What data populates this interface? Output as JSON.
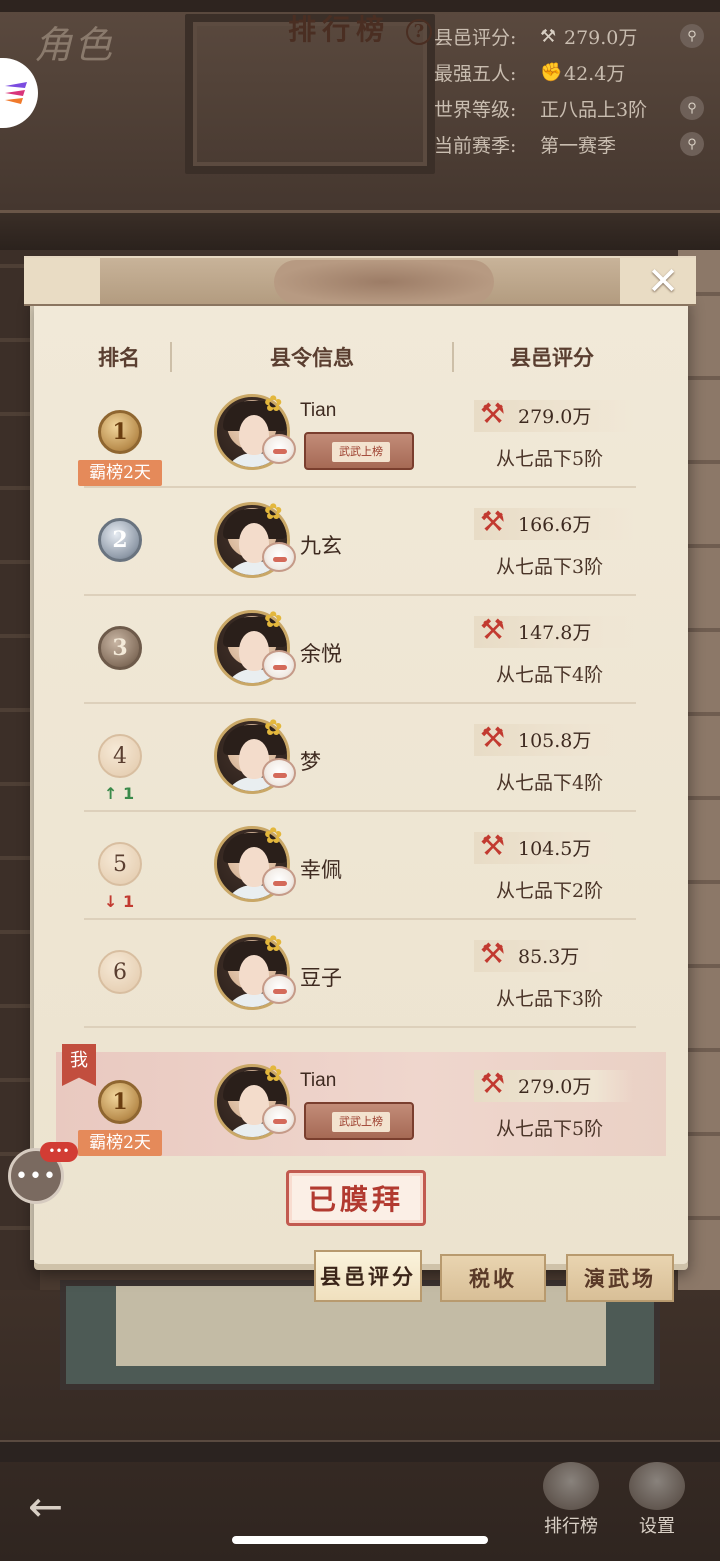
{
  "page": {
    "title": "角色"
  },
  "stats": [
    {
      "label": "县邑评分:",
      "icon": "axe-icon",
      "glyph": "⚒",
      "value": "279.0万"
    },
    {
      "label": "最强五人:",
      "icon": "fist-icon",
      "glyph": "✊",
      "value": "42.4万"
    },
    {
      "label": "世界等级:",
      "icon": "",
      "glyph": "",
      "value": "正八品上3阶"
    },
    {
      "label": "当前赛季:",
      "icon": "",
      "glyph": "",
      "value": "第一赛季"
    }
  ],
  "board": {
    "title": "排行榜",
    "help": "?",
    "close": "✕",
    "headers": {
      "rank": "排名",
      "info": "县令信息",
      "score": "县邑评分"
    },
    "rows": [
      {
        "rank": "1",
        "medal": "gold",
        "tag": "霸榜2天",
        "change": "",
        "name": "Tian",
        "badge": "武武上榜",
        "score": "279.0万",
        "grade": "从七品下5阶"
      },
      {
        "rank": "2",
        "medal": "silver",
        "tag": "",
        "change": "",
        "name": "九玄",
        "badge": "",
        "score": "166.6万",
        "grade": "从七品下3阶"
      },
      {
        "rank": "3",
        "medal": "bronze",
        "tag": "",
        "change": "",
        "name": "余悦",
        "badge": "",
        "score": "147.8万",
        "grade": "从七品下4阶"
      },
      {
        "rank": "4",
        "medal": "plain",
        "tag": "",
        "change": "↑ 1",
        "name": "梦",
        "badge": "",
        "score": "105.8万",
        "grade": "从七品下4阶"
      },
      {
        "rank": "5",
        "medal": "plain",
        "tag": "",
        "change": "↓ 1",
        "name": "幸佩",
        "badge": "",
        "score": "104.5万",
        "grade": "从七品下2阶"
      },
      {
        "rank": "6",
        "medal": "plain",
        "tag": "",
        "change": "",
        "name": "豆子",
        "badge": "",
        "score": "85.3万",
        "grade": "从七品下3阶"
      }
    ],
    "me": {
      "flag": "我",
      "rank": "1",
      "tag": "霸榜2天",
      "name": "Tian",
      "badge": "武武上榜",
      "score": "279.0万",
      "grade": "从七品下5阶"
    },
    "worship_button": "已膜拜"
  },
  "chat": {
    "dots": "•••"
  },
  "tabs": [
    {
      "label": "县邑评分",
      "active": true
    },
    {
      "label": "税收",
      "active": false
    },
    {
      "label": "演武场",
      "active": false
    }
  ],
  "bottom_nav": {
    "back": "←",
    "ranking": "排行榜",
    "settings": "设置"
  },
  "colors": {
    "accent_red": "#c23a30",
    "gold": "#c9a766",
    "paper": "#f1e9d8"
  }
}
